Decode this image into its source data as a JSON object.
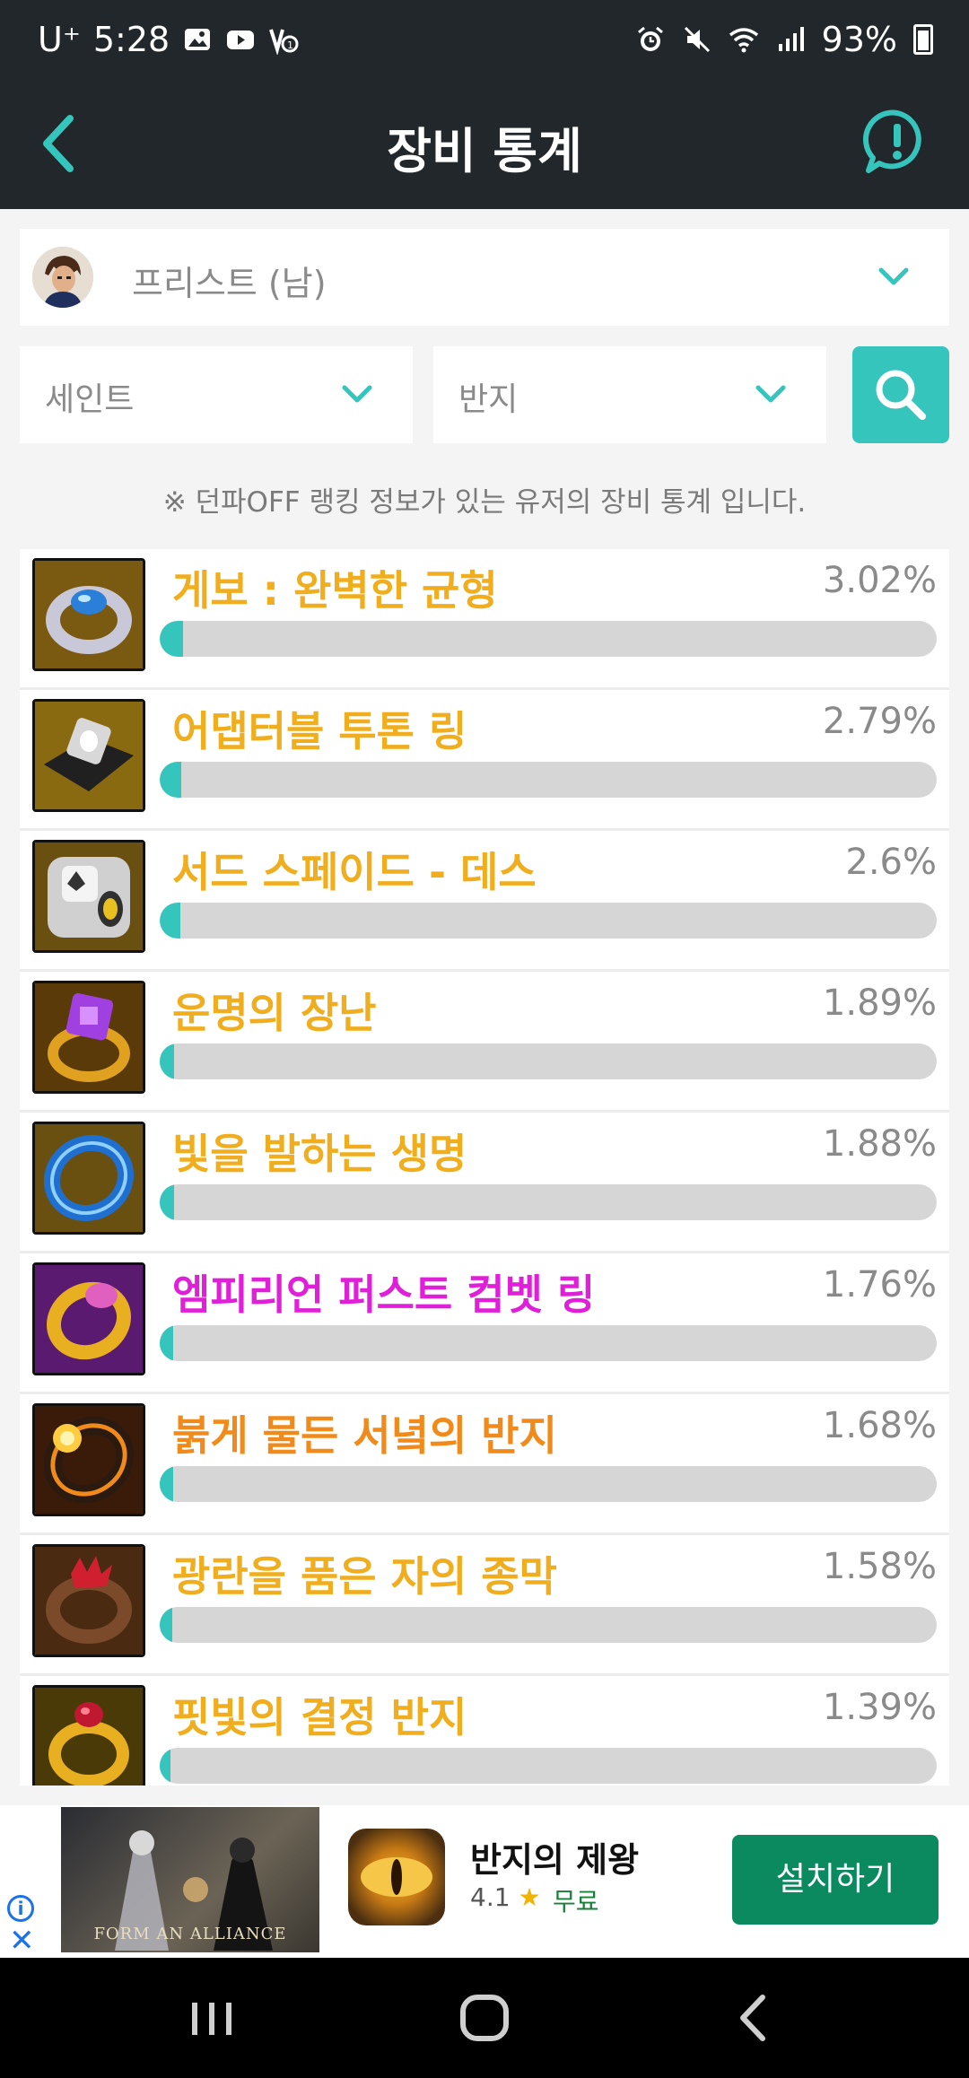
{
  "status_bar": {
    "carrier": "U⁺",
    "time": "5:28",
    "battery": "93%"
  },
  "header": {
    "title": "장비 통계"
  },
  "class_selector": {
    "value": "프리스트 (남)"
  },
  "filters": {
    "set": "세인트",
    "slot": "반지"
  },
  "notice": "※ 던파OFF 랭킹 정보가 있는 유저의 장비 통계 입니다.",
  "items": [
    {
      "name": "게보 : 완벽한 균형",
      "percent": "3.02%",
      "value": 3.02,
      "color": "#f0ae1f"
    },
    {
      "name": "어댑터블 투톤 링",
      "percent": "2.79%",
      "value": 2.79,
      "color": "#f0ae1f"
    },
    {
      "name": "서드 스페이드 - 데스",
      "percent": "2.6%",
      "value": 2.6,
      "color": "#f0ae1f"
    },
    {
      "name": "운명의 장난",
      "percent": "1.89%",
      "value": 1.89,
      "color": "#f0ae1f"
    },
    {
      "name": "빛을 발하는 생명",
      "percent": "1.88%",
      "value": 1.88,
      "color": "#f0ae1f"
    },
    {
      "name": "엠피리언 퍼스트 컴벳 링",
      "percent": "1.76%",
      "value": 1.76,
      "color": "#e020d8"
    },
    {
      "name": "붉게 물든 서녘의 반지",
      "percent": "1.68%",
      "value": 1.68,
      "color": "#f08a1a"
    },
    {
      "name": "광란을 품은 자의 종막",
      "percent": "1.58%",
      "value": 1.58,
      "color": "#f0ae1f"
    },
    {
      "name": "핏빛의 결정 반지",
      "percent": "1.39%",
      "value": 1.39,
      "color": "#f0ae1f"
    }
  ],
  "ad": {
    "banner_text": "FORM AN ALLIANCE",
    "app_name": "반지의 제왕",
    "rating": "4.1",
    "price": "무료",
    "install_label": "설치하기"
  },
  "colors": {
    "accent": "#36c5bd",
    "header_bg": "#22272b"
  }
}
